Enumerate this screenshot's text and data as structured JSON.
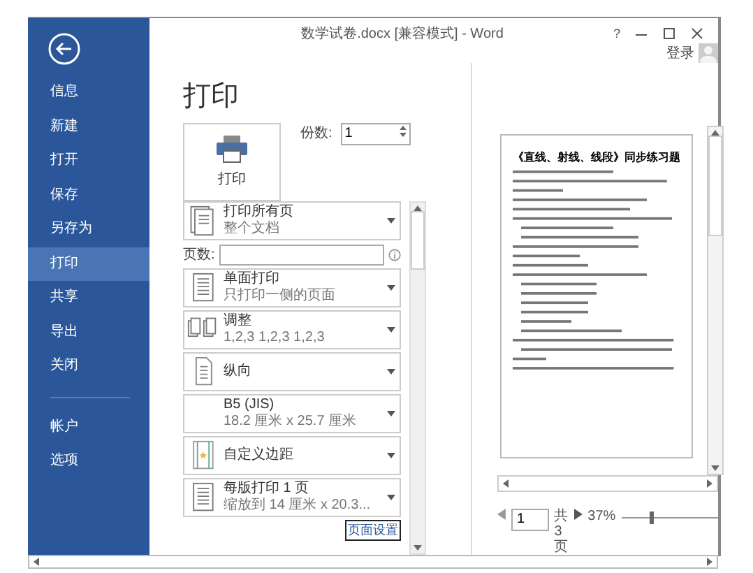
{
  "window": {
    "title": "数学试卷.docx [兼容模式] - Word",
    "help": "?",
    "account": "登录"
  },
  "sidebar": {
    "items": [
      {
        "label": "信息",
        "selected": false
      },
      {
        "label": "新建",
        "selected": false
      },
      {
        "label": "打开",
        "selected": false
      },
      {
        "label": "保存",
        "selected": false
      },
      {
        "label": "另存为",
        "selected": false
      },
      {
        "label": "打印",
        "selected": true
      },
      {
        "label": "共享",
        "selected": false
      },
      {
        "label": "导出",
        "selected": false
      },
      {
        "label": "关闭",
        "selected": false
      }
    ],
    "bottom_items": [
      {
        "label": "帐户",
        "selected": false
      },
      {
        "label": "选项",
        "selected": false
      }
    ]
  },
  "print": {
    "heading": "打印",
    "print_button": "打印",
    "copies_label": "份数:",
    "copies": "1",
    "pages_label": "页数:",
    "settings": [
      {
        "kind": "range",
        "title": "打印所有页",
        "detail": "整个文档"
      },
      {
        "kind": "pages"
      },
      {
        "kind": "sides",
        "title": "单面打印",
        "detail": "只打印一侧的页面"
      },
      {
        "kind": "collate",
        "title": "调整",
        "detail": "1,2,3    1,2,3    1,2,3"
      },
      {
        "kind": "orientation",
        "title": "纵向"
      },
      {
        "kind": "paper",
        "title": "B5 (JIS)",
        "detail": "18.2 厘米 x 25.7 厘米"
      },
      {
        "kind": "margins",
        "title": "自定义边距"
      },
      {
        "kind": "persheet",
        "title": "每版打印 1 页",
        "detail": "缩放到 14 厘米 x 20.3..."
      }
    ],
    "page_setup_link": "页面设置"
  },
  "preview": {
    "document_title": "《直线、射线、线段》同步练习题",
    "page": "1",
    "total": "共 3 页",
    "zoom": "37%",
    "zoom_slider": {
      "level": 0.3
    }
  }
}
